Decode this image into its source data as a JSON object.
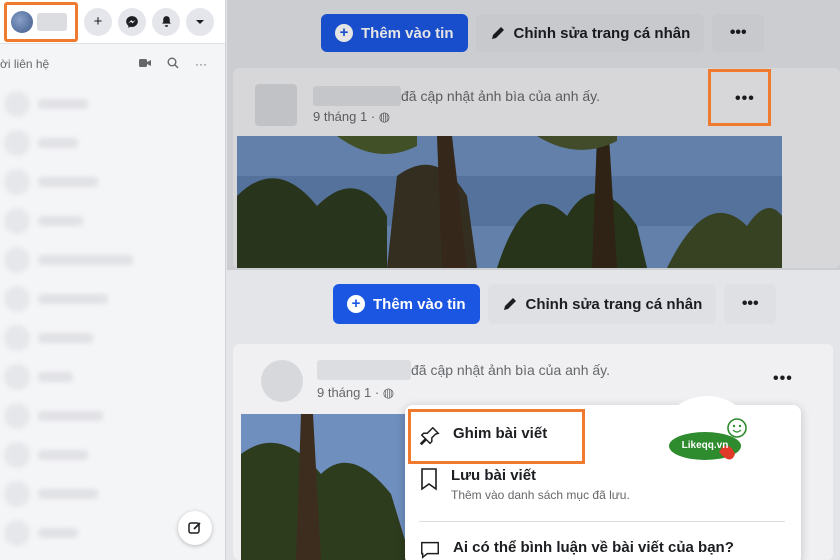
{
  "sidebar": {
    "contacts_label": "ời liên hệ",
    "top_buttons": [
      "+"
    ]
  },
  "toolbar": {
    "add_story": "Thêm vào tin",
    "edit_profile": "Chỉnh sửa trang cá nhân",
    "more": "•••"
  },
  "post": {
    "action": "đã cập nhật ảnh bìa của anh ấy.",
    "time": "9 tháng 1 ·",
    "more": "•••"
  },
  "menu": {
    "items": [
      {
        "title": "Ghim bài viết",
        "subtitle": ""
      },
      {
        "title": "Lưu bài viết",
        "subtitle": "Thêm vào danh sách mục đã lưu."
      },
      {
        "title": "Ai có thể bình luận về bài viết của bạn?",
        "subtitle": ""
      }
    ]
  },
  "logo": {
    "text": "Likeqq.vn"
  },
  "colors": {
    "accent": "#1b56e3",
    "highlight": "#f07a2e"
  }
}
